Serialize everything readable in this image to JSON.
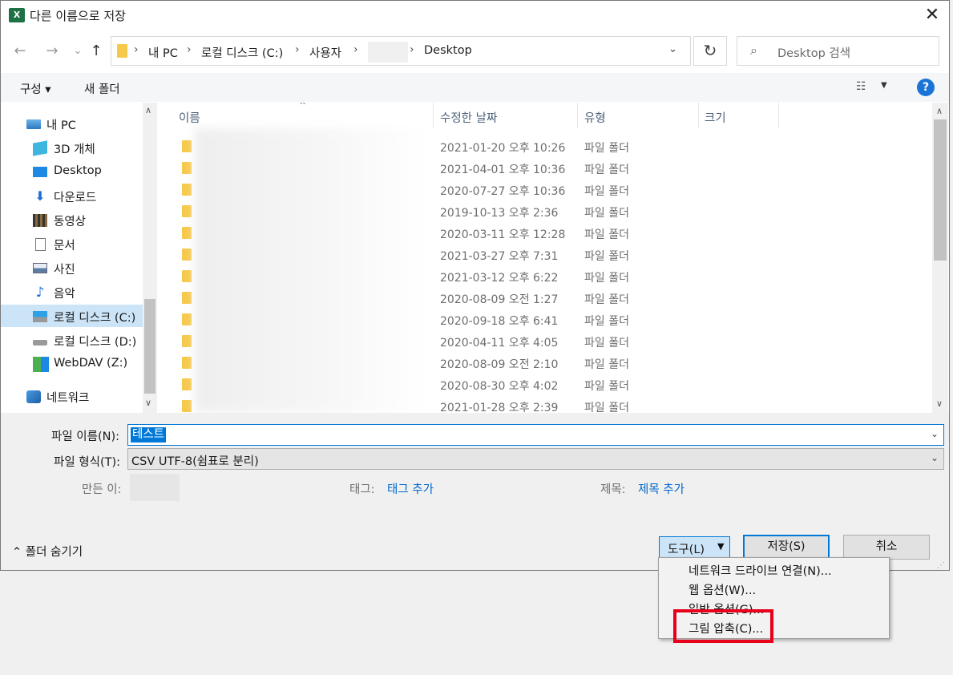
{
  "window": {
    "title": "다른 이름으로 저장",
    "app_icon": "excel-icon",
    "close_glyph": "✕"
  },
  "nav_buttons": {
    "back": "←",
    "forward": "→",
    "recent": "⌄",
    "up": "↑"
  },
  "address": {
    "crumbs": [
      "내 PC",
      "로컬 디스크 (C:)",
      "사용자",
      "Desktop"
    ],
    "separator": "›",
    "dropdown": "⌄",
    "refresh": "↻"
  },
  "search": {
    "placeholder": "Desktop 검색",
    "icon": "⌕"
  },
  "toolbar": {
    "organize_label": "구성 ▾",
    "new_folder_label": "새 폴더",
    "view_glyph": "☷",
    "view_dropdown": "▼",
    "help": "?"
  },
  "sidebar": {
    "items": [
      {
        "label": "내 PC",
        "icon": "computer-icon"
      },
      {
        "label": "3D 개체",
        "icon": "3d-objects-icon"
      },
      {
        "label": "Desktop",
        "icon": "desktop-icon"
      },
      {
        "label": "다운로드",
        "icon": "download-icon"
      },
      {
        "label": "동영상",
        "icon": "video-icon"
      },
      {
        "label": "문서",
        "icon": "document-icon"
      },
      {
        "label": "사진",
        "icon": "picture-icon"
      },
      {
        "label": "음악",
        "icon": "music-icon"
      },
      {
        "label": "로컬 디스크 (C:)",
        "icon": "windows-drive-icon",
        "selected": true
      },
      {
        "label": "로컬 디스크 (D:)",
        "icon": "drive-icon"
      },
      {
        "label": "WebDAV (Z:)",
        "icon": "network-drive-icon"
      },
      {
        "label": "네트워크",
        "icon": "network-icon"
      }
    ],
    "scroll_up": "∧",
    "scroll_down": "∨"
  },
  "columns": {
    "name": "이름",
    "modified": "수정한 날짜",
    "type": "유형",
    "size": "크기",
    "sort_arrow": "^"
  },
  "files": [
    {
      "date": "2021-01-20 오후 10:26",
      "type": "파일 폴더"
    },
    {
      "date": "2021-04-01 오후 10:36",
      "type": "파일 폴더"
    },
    {
      "date": "2020-07-27 오후 10:36",
      "type": "파일 폴더"
    },
    {
      "date": "2019-10-13 오후 2:36",
      "type": "파일 폴더"
    },
    {
      "date": "2020-03-11 오후 12:28",
      "type": "파일 폴더"
    },
    {
      "date": "2021-03-27 오후 7:31",
      "type": "파일 폴더"
    },
    {
      "date": "2021-03-12 오후 6:22",
      "type": "파일 폴더"
    },
    {
      "date": "2020-08-09 오전 1:27",
      "type": "파일 폴더"
    },
    {
      "date": "2020-09-18 오후 6:41",
      "type": "파일 폴더"
    },
    {
      "date": "2020-04-11 오후 4:05",
      "type": "파일 폴더"
    },
    {
      "date": "2020-08-09 오전 2:10",
      "type": "파일 폴더"
    },
    {
      "date": "2020-08-30 오후 4:02",
      "type": "파일 폴더"
    },
    {
      "date": "2021-01-28 오후 2:39",
      "type": "파일 폴더"
    }
  ],
  "form": {
    "filename_label": "파일 이름(N):",
    "filename_value": "테스트",
    "filetype_label": "파일 형식(T):",
    "filetype_value": "CSV UTF-8(쉼표로 분리)",
    "author_label": "만든 이:",
    "tags_label": "태그:",
    "tags_link": "태그 추가",
    "title_label": "제목:",
    "title_link": "제목 추가",
    "dropdown_glyph": "⌄"
  },
  "footer": {
    "hide_folders_label": "⌃ 폴더 숨기기",
    "tools_label": "도구(L)",
    "tools_arrow": "▼",
    "save_label": "저장(S)",
    "cancel_label": "취소",
    "grip": "⋰"
  },
  "tools_menu": [
    "네트워크 드라이브 연결(N)...",
    "웹 옵션(W)...",
    "일반 옵션(G)...",
    "그림 압축(C)..."
  ],
  "colors": {
    "accent": "#0078d7",
    "highlight": "#e8001a",
    "folder": "#f7c94a",
    "selected": "#cce4f7"
  }
}
